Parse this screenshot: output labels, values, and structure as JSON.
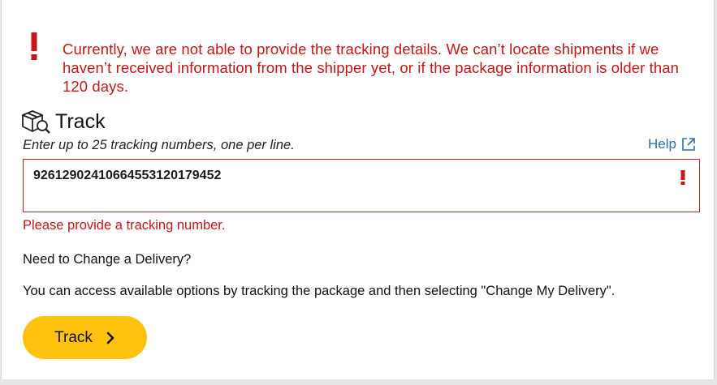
{
  "alert": {
    "message": "Currently, we are not able to provide the tracking details. We can’t locate shipments if we haven’t received information from the shipper yet, or if the package information is older than 120 days.",
    "icon": "exclamation-icon",
    "color": "#c41717"
  },
  "track": {
    "heading": "Track",
    "heading_icon": "package-search-icon",
    "instructions": "Enter up to 25 tracking numbers, one per line.",
    "help_label": "Help",
    "help_icon": "external-link-icon",
    "input_value": "9261290241066455312017945​2",
    "error_icon": "exclamation-icon",
    "error_message": "Please provide a tracking number."
  },
  "change_delivery": {
    "title": "Need to Change a Delivery?",
    "description": "You can access available options by tracking the package and then selecting \"Change My Delivery\"."
  },
  "button": {
    "label": "Track",
    "icon": "chevron-right-icon",
    "color": "#ffc20e"
  }
}
